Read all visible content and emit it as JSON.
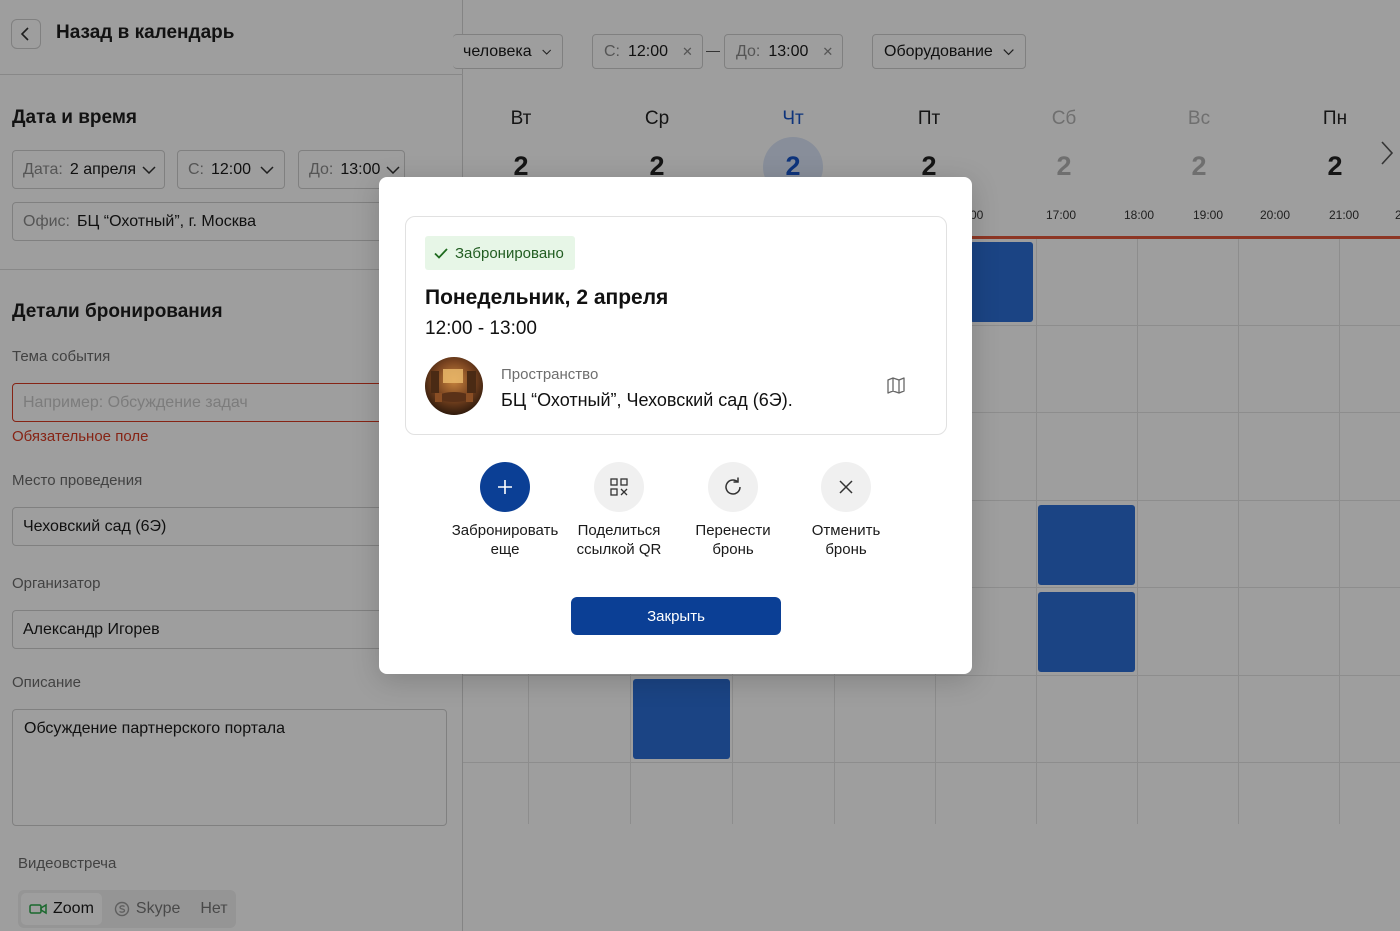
{
  "left_panel": {
    "back_label": "Назад в календарь",
    "datetime": {
      "title": "Дата и время",
      "date_label": "Дата:",
      "date_value": "2 апреля",
      "from_label": "С:",
      "from_value": "12:00",
      "to_label": "До:",
      "to_value": "13:00",
      "office_label": "Офис:",
      "office_value": "БЦ “Охотный”, г. Москва"
    },
    "details": {
      "title": "Детали бронирования",
      "topic_label": "Тема события",
      "topic_placeholder": "Например: Обсуждение задач",
      "topic_error": "Обязательное поле",
      "place_label": "Место проведения",
      "place_value": "Чеховский сад (6Э)",
      "organizer_label": "Организатор",
      "organizer_value": "Александр Игорев",
      "description_label": "Описание",
      "description_value": "Обсуждение партнерского портала",
      "video_label": "Видеовстреча",
      "video_options": [
        "Zoom",
        "Skype",
        "Нет"
      ],
      "video_selected": "Zoom"
    }
  },
  "calendar": {
    "filters": {
      "people": "человека",
      "from_label": "С:",
      "from_value": "12:00",
      "to_label": "До:",
      "to_value": "13:00",
      "equipment": "Оборудование"
    },
    "days": [
      {
        "name": "Вт",
        "num": "2",
        "type": "normal"
      },
      {
        "name": "Ср",
        "num": "2",
        "type": "normal"
      },
      {
        "name": "Чт",
        "num": "2",
        "type": "today"
      },
      {
        "name": "Пт",
        "num": "2",
        "type": "normal"
      },
      {
        "name": "Сб",
        "num": "2",
        "type": "weekend"
      },
      {
        "name": "Вс",
        "num": "2",
        "type": "weekend"
      },
      {
        "name": "Пн",
        "num": "2",
        "type": "normal"
      }
    ],
    "times": [
      "00",
      "17:00",
      "18:00",
      "19:00",
      "20:00",
      "21:00",
      "2"
    ]
  },
  "modal": {
    "status": "Забронировано",
    "title": "Понедельник, 2 апреля",
    "time": "12:00 - 13:00",
    "space_caption": "Пространство",
    "space_name": "БЦ “Охотный”, Чеховский сад (6Э).",
    "actions": [
      {
        "label": "Забронировать\nеще",
        "icon": "plus-icon"
      },
      {
        "label": "Поделиться\nссылкой QR",
        "icon": "qr-code-icon"
      },
      {
        "label": "Перенести\nбронь",
        "icon": "refresh-icon"
      },
      {
        "label": "Отменить\nбронь",
        "icon": "close-icon"
      }
    ],
    "close_label": "Закрыть"
  },
  "colors": {
    "primary": "#0b3f95",
    "event": "#2d6fd6",
    "error": "#d93a22",
    "now_line": "#e4583b",
    "success_bg": "#e7f6e7"
  }
}
